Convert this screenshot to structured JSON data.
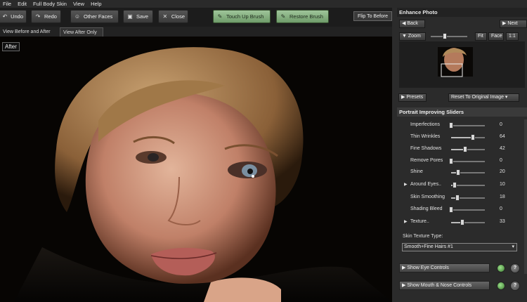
{
  "menu": [
    "File",
    "Edit",
    "Full Body Skin",
    "View",
    "Help"
  ],
  "toolbar": {
    "undo": "Undo",
    "redo": "Redo",
    "other_faces": "Other Faces",
    "save": "Save",
    "close": "Close",
    "touch_up": "Touch Up Brush",
    "restore": "Restore Brush",
    "flip": "Flip To Before"
  },
  "tabs": [
    "View Before and After",
    "View After Only"
  ],
  "photo": {
    "label": "After"
  },
  "panel": {
    "title": "Enhance Photo",
    "back": "Back",
    "next": "Next",
    "zoom": "Zoom",
    "fit": "Fit",
    "face": "Face",
    "one_to_one": "1:1",
    "presets": "Presets",
    "reset": "Reset To Original Image",
    "sliders_title": "Portrait Improving Sliders",
    "sliders": [
      {
        "label": "Imperfections",
        "value": 0,
        "expandable": false
      },
      {
        "label": "Thin Wrinkles",
        "value": 64,
        "expandable": false
      },
      {
        "label": "Fine Shadows",
        "value": 42,
        "expandable": false
      },
      {
        "label": "Remove Pores",
        "value": 0,
        "expandable": false
      },
      {
        "label": "Shine",
        "value": 20,
        "expandable": false
      },
      {
        "label": "Around Eyes..",
        "value": 10,
        "expandable": true
      },
      {
        "label": "Skin Smoothing",
        "value": 18,
        "expandable": false
      },
      {
        "label": "Shading Bleed",
        "value": 0,
        "expandable": false
      },
      {
        "label": "Texture..",
        "value": 33,
        "expandable": true
      }
    ],
    "texture_type_label": "Skin Texture Type:",
    "texture_type_value": "Smooth+Fine Hairs #1",
    "eye_controls": "Show Eye Controls",
    "mouth_controls": "Show Mouth & Nose Controls",
    "help": "?"
  }
}
